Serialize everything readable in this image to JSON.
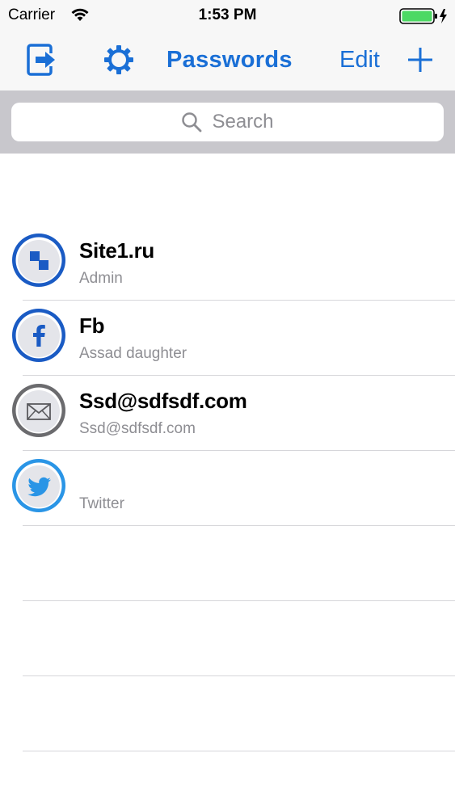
{
  "status_bar": {
    "carrier": "Carrier",
    "time": "1:53 PM",
    "battery_color": "#4cd964"
  },
  "nav": {
    "title": "Passwords",
    "edit_label": "Edit",
    "logout_icon": "logout-icon",
    "settings_icon": "gear-icon",
    "add_icon": "plus-icon",
    "tint_color": "#1a6fd6"
  },
  "search": {
    "placeholder": "Search"
  },
  "entries": [
    {
      "title": "Site1.ru",
      "subtitle": "Admin",
      "icon": "site-icon"
    },
    {
      "title": "Fb",
      "subtitle": "Assad daughter",
      "icon": "facebook-icon"
    },
    {
      "title": "Ssd@sdfsdf.com",
      "subtitle": "Ssd@sdfsdf.com",
      "icon": "mail-icon"
    },
    {
      "title": "",
      "subtitle": "Twitter",
      "icon": "twitter-icon"
    }
  ]
}
